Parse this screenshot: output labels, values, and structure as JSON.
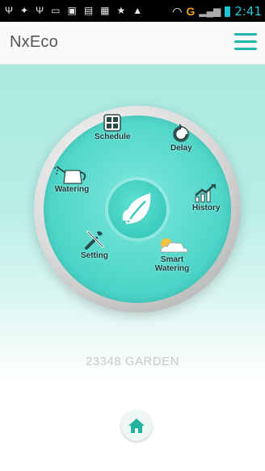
{
  "status_bar": {
    "time": "2:41",
    "network": "G"
  },
  "app": {
    "title": "NxEco"
  },
  "dial": {
    "items": [
      {
        "label": "Schedule"
      },
      {
        "label": "Delay"
      },
      {
        "label": "History"
      },
      {
        "label": "Smart Watering"
      },
      {
        "label": "Setting"
      },
      {
        "label": "Watering"
      }
    ]
  },
  "garden": {
    "name": "23348 GARDEN"
  },
  "colors": {
    "accent": "#1fb8a8",
    "dial": "#4fd6c9",
    "time": "#1fc7d4"
  }
}
